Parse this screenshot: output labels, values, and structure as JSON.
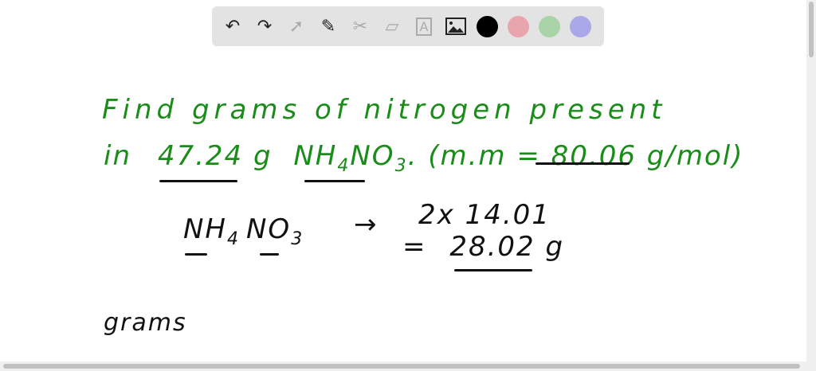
{
  "toolbar": {
    "tools": [
      "undo-icon",
      "redo-icon",
      "select-icon",
      "pen-icon",
      "tools-icon",
      "eraser-icon",
      "text-icon",
      "image-icon"
    ],
    "colors": [
      "#000000",
      "#e8a5ad",
      "#a9d4a7",
      "#aaa8e8"
    ],
    "text_tool_label": "A"
  },
  "board": {
    "line1": "Find grams of nitrogen present",
    "line2_in": "in",
    "line2_mass": "47.24",
    "line2_g": "g",
    "line2_nh": "NH",
    "line2_sub4": "4",
    "line2_no": "NO",
    "line2_sub3": "3",
    "line2_mm": ". (m.m =",
    "line2_molar": "80.06 g",
    "line2_unit": "/mol)",
    "formula_nh": "NH",
    "formula_sub4": "4",
    "formula_no": "NO",
    "formula_sub3": "3",
    "arrow": "→",
    "calc1": "2x 14.01",
    "calc2_eq": "=",
    "calc2_val": "28.02",
    "calc2_unit": "g",
    "bottom": "grams"
  },
  "accent_green": "#1a8c1a"
}
